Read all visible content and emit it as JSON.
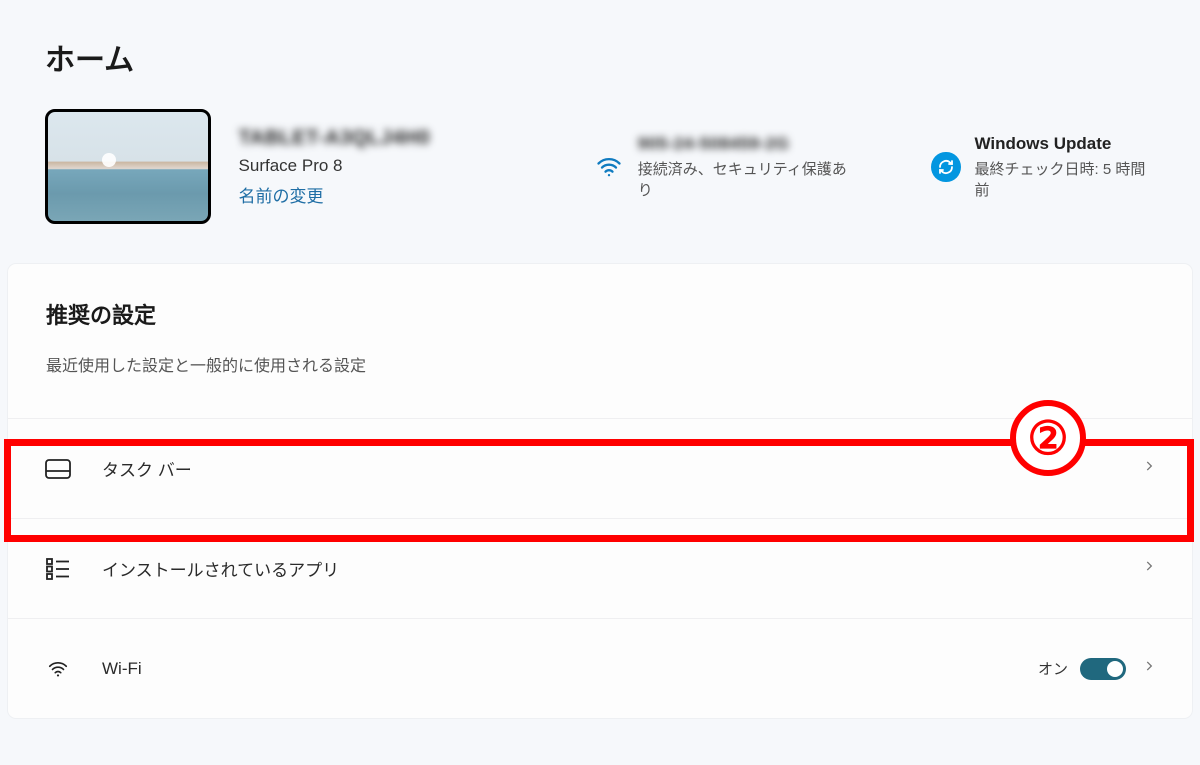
{
  "page_title": "ホーム",
  "device": {
    "name": "TABLET-A3QLJ4H0",
    "model": "Surface Pro 8",
    "rename_label": "名前の変更"
  },
  "wifi_card": {
    "ssid": "905-24-508459-2G",
    "status": "接続済み、セキュリティ保護あり"
  },
  "update_card": {
    "title": "Windows Update",
    "status": "最終チェック日時: 5 時間前"
  },
  "recommended": {
    "title": "推奨の設定",
    "subtitle": "最近使用した設定と一般的に使用される設定",
    "items": [
      {
        "icon": "taskbar",
        "label": "タスク バー"
      },
      {
        "icon": "apps",
        "label": "インストールされているアプリ"
      },
      {
        "icon": "wifi",
        "label": "Wi-Fi",
        "state_text": "オン",
        "toggle": true
      }
    ]
  },
  "annotation": {
    "number": "②"
  }
}
